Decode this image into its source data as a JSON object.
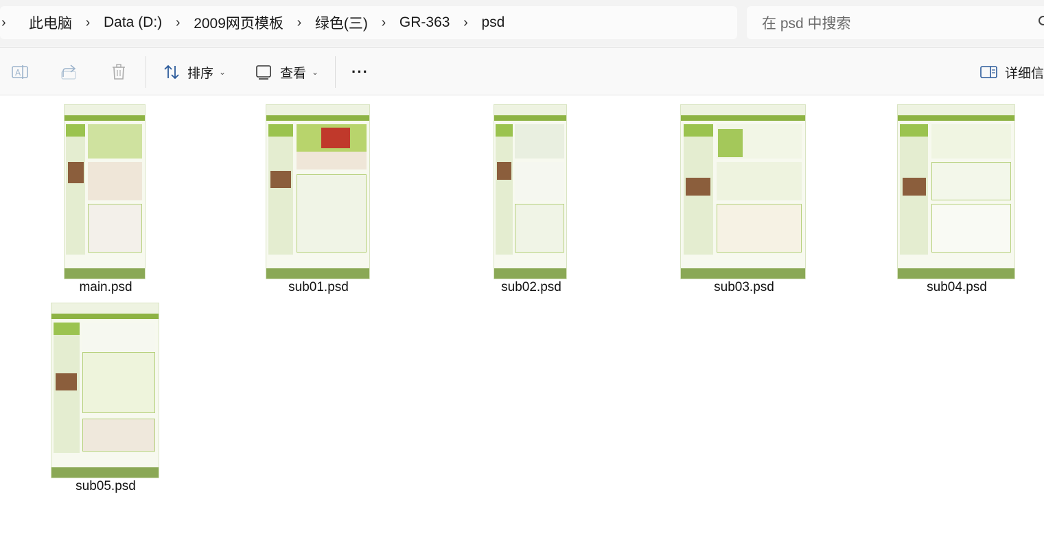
{
  "breadcrumb": {
    "items": [
      "此电脑",
      "Data (D:)",
      "2009网页模板",
      "绿色(三)",
      "GR-363",
      "psd"
    ]
  },
  "search": {
    "placeholder": "在 psd 中搜索"
  },
  "toolbar": {
    "sort_label": "排序",
    "view_label": "查看",
    "more_label": "···",
    "details_label": "详细信"
  },
  "files": [
    {
      "name": "main.psd"
    },
    {
      "name": "sub01.psd"
    },
    {
      "name": "sub02.psd"
    },
    {
      "name": "sub03.psd"
    },
    {
      "name": "sub04.psd"
    },
    {
      "name": "sub05.psd"
    }
  ],
  "colors": {
    "thumb_green": "#8db343",
    "thumb_light": "#e4edd0",
    "footer_green": "#8aa855"
  }
}
